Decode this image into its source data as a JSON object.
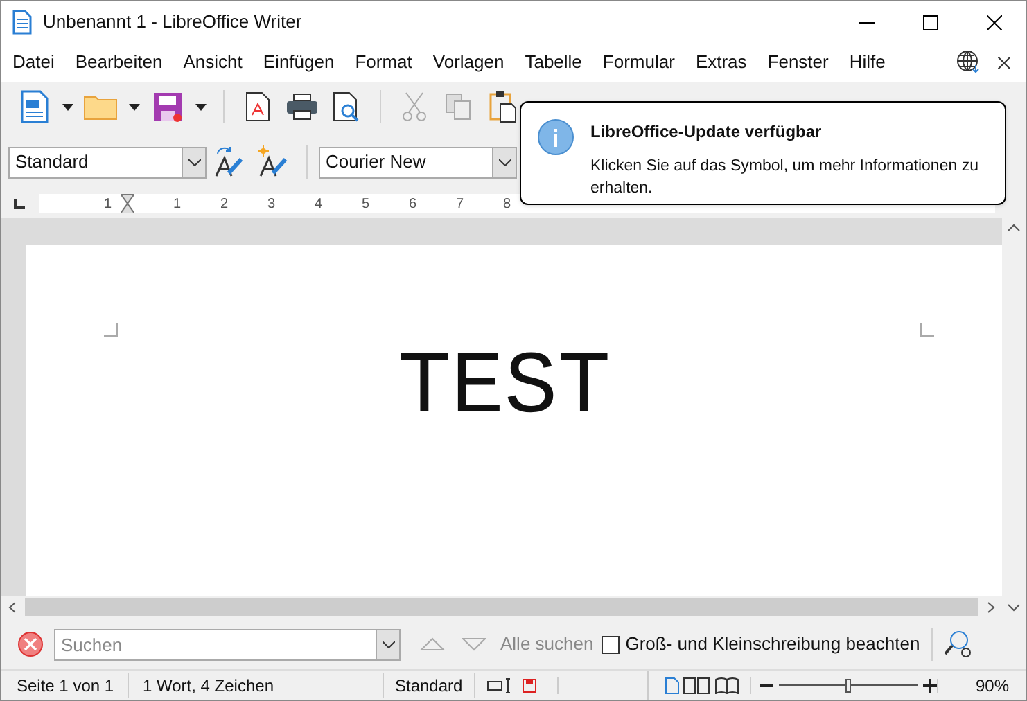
{
  "window": {
    "title": "Unbenannt 1 - LibreOffice Writer"
  },
  "menu": [
    "Datei",
    "Bearbeiten",
    "Ansicht",
    "Einfügen",
    "Format",
    "Vorlagen",
    "Tabelle",
    "Formular",
    "Extras",
    "Fenster",
    "Hilfe"
  ],
  "formatting": {
    "paragraph_style": "Standard",
    "font_name": "Courier New"
  },
  "ruler": {
    "labels": [
      "1",
      "1",
      "2",
      "3",
      "4",
      "5",
      "6",
      "7",
      "8"
    ]
  },
  "notification": {
    "title": "LibreOffice-Update verfügbar",
    "message": "Klicken Sie auf das Symbol, um mehr Informationen zu erhalten."
  },
  "document": {
    "text": "TEST"
  },
  "find_bar": {
    "placeholder": "Suchen",
    "find_all": "Alle suchen",
    "match_case": {
      "label": "Groß- und Kleinschreibung beachten",
      "checked": false
    }
  },
  "status_bar": {
    "page": "Seite 1 von 1",
    "words": "1 Wort, 4 Zeichen",
    "style": "Standard",
    "modified": true,
    "level": 0.5,
    "zoom": "90%"
  }
}
